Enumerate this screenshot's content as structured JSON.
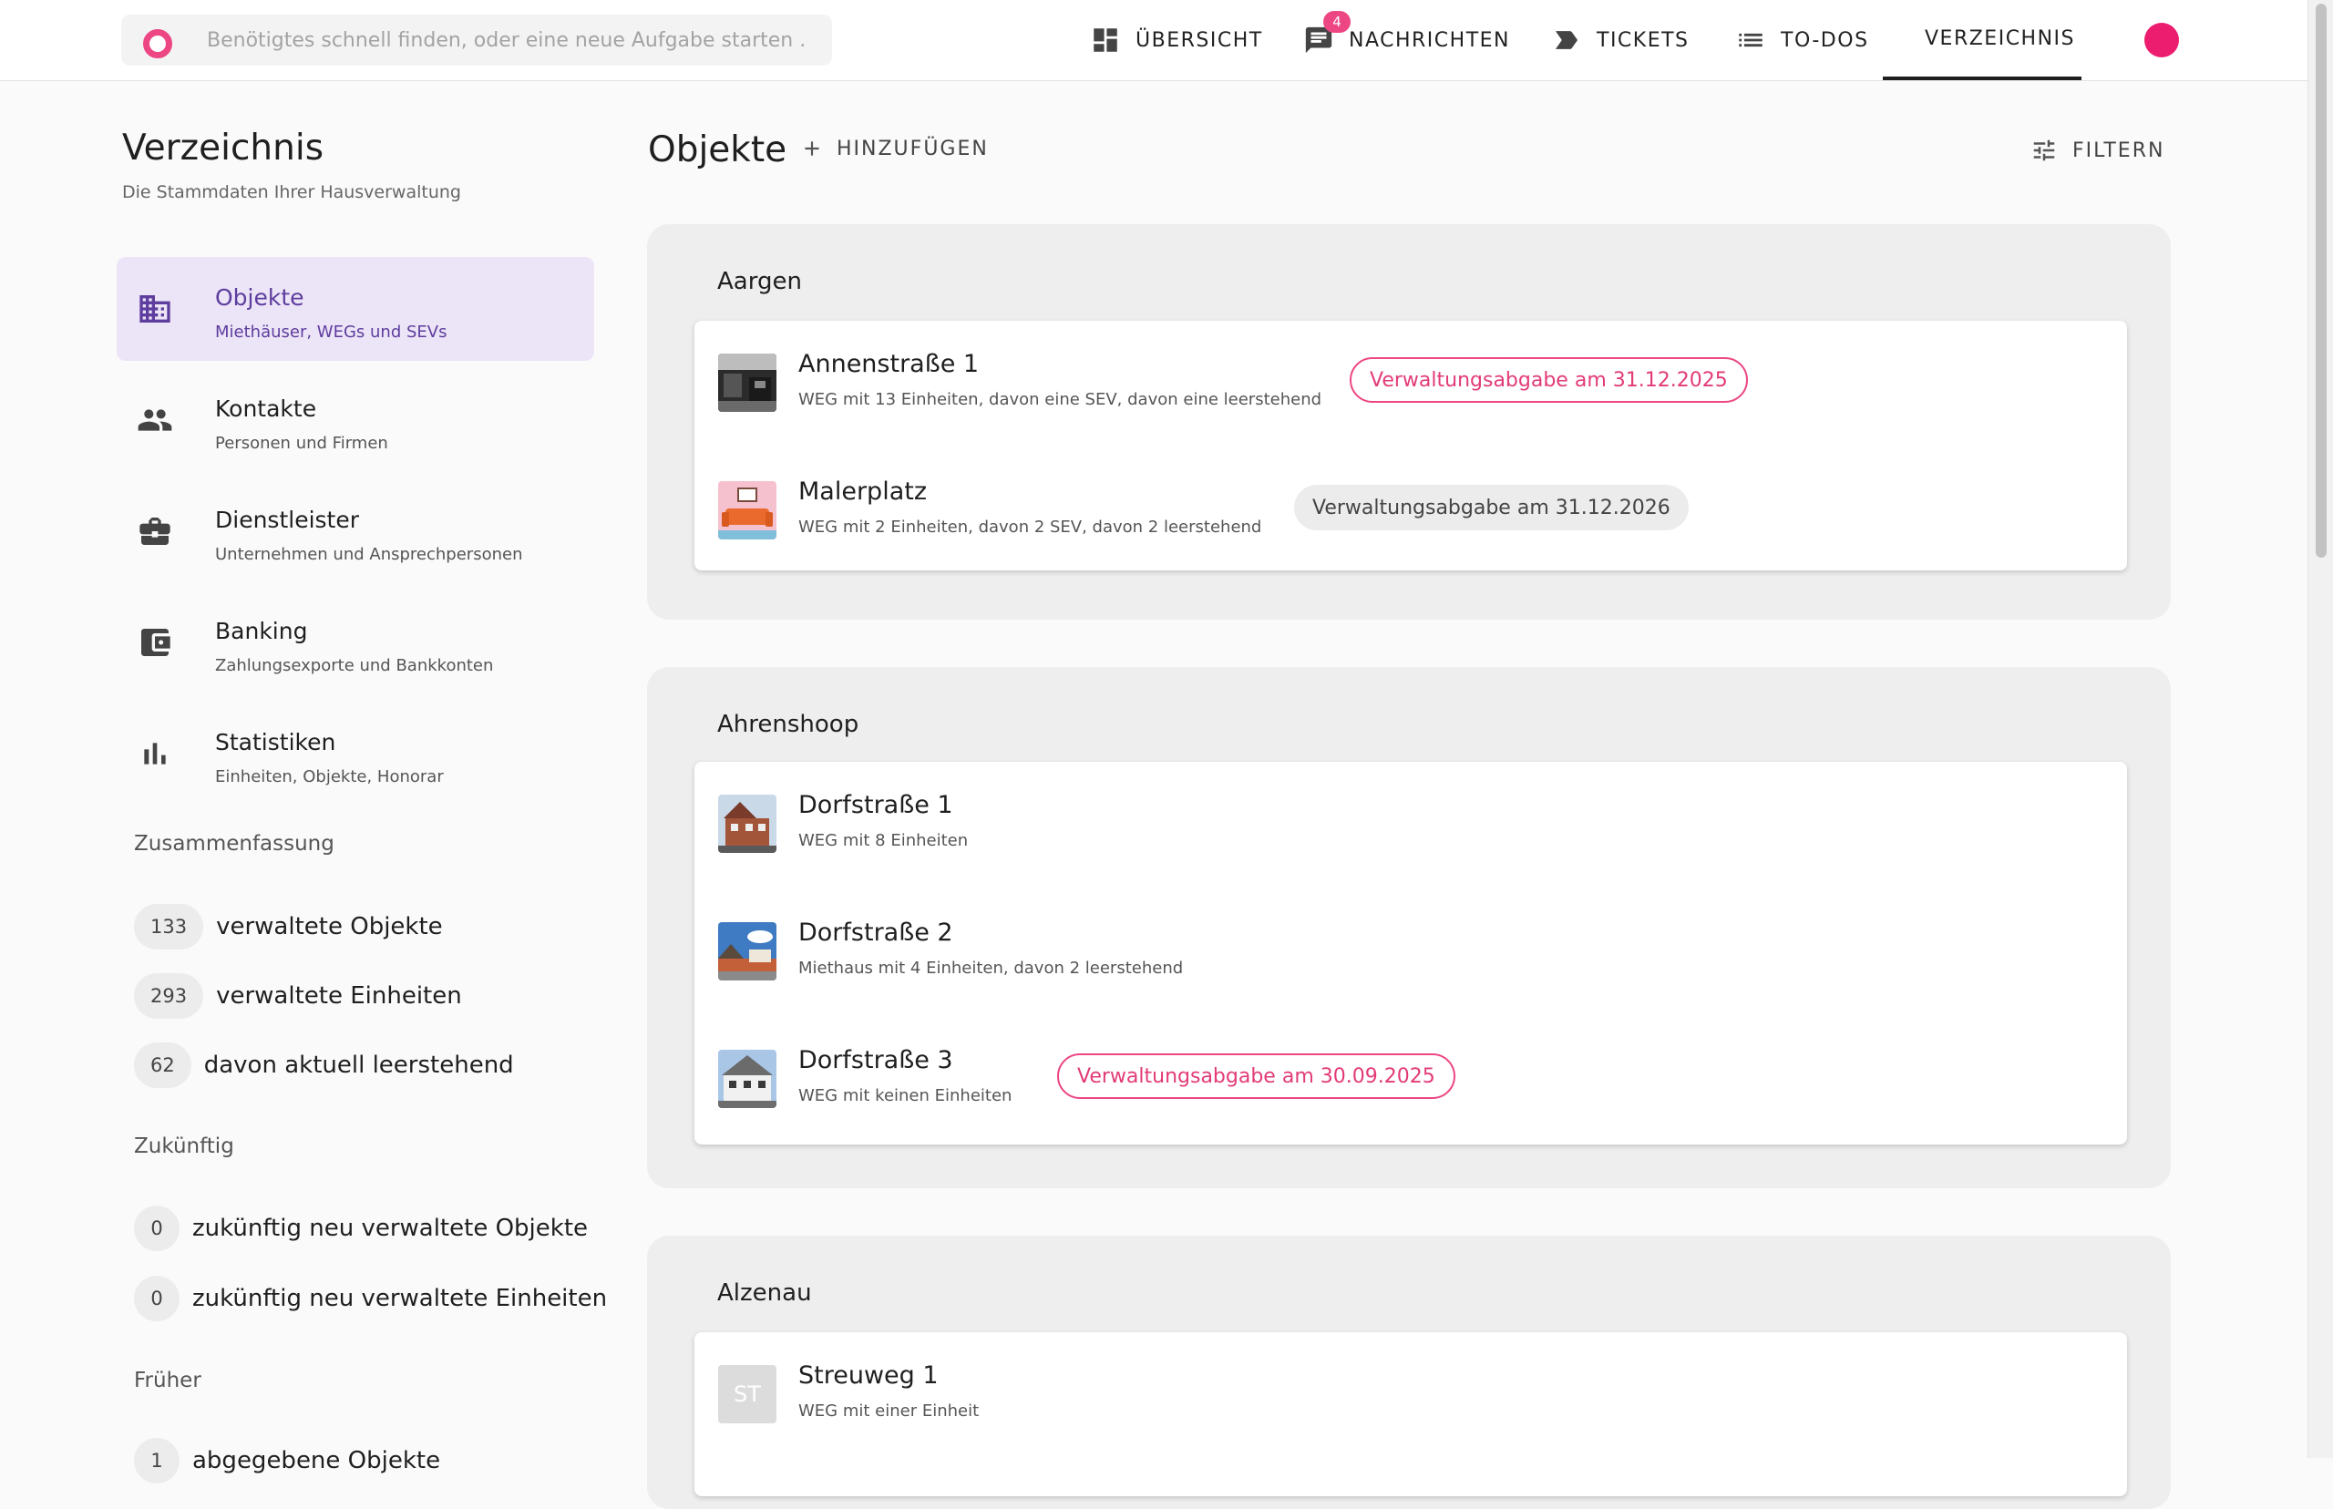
{
  "search": {
    "placeholder": "Benötigtes schnell finden, oder eine neue Aufgabe starten ..."
  },
  "nav": {
    "items": [
      {
        "label": "ÜBERSICHT",
        "icon": "dashboard-icon"
      },
      {
        "label": "NACHRICHTEN",
        "icon": "chat-icon",
        "badge": "4"
      },
      {
        "label": "TICKETS",
        "icon": "label-icon"
      },
      {
        "label": "TO-DOS",
        "icon": "list-icon"
      },
      {
        "label": "VERZEICHNIS",
        "icon": "layers-icon",
        "active": true
      }
    ]
  },
  "sidebar": {
    "title": "Verzeichnis",
    "subtitle": "Die Stammdaten Ihrer Hausverwaltung",
    "items": [
      {
        "label": "Objekte",
        "desc": "Miethäuser, WEGs und SEVs",
        "icon": "building-icon",
        "active": true
      },
      {
        "label": "Kontakte",
        "desc": "Personen und Firmen",
        "icon": "people-icon"
      },
      {
        "label": "Dienstleister",
        "desc": "Unternehmen und Ansprechpersonen",
        "icon": "briefcase-icon"
      },
      {
        "label": "Banking",
        "desc": "Zahlungsexporte und Bankkonten",
        "icon": "wallet-icon"
      },
      {
        "label": "Statistiken",
        "desc": "Einheiten, Objekte, Honorar",
        "icon": "bar-chart-icon"
      }
    ],
    "summary": {
      "heading": "Zusammenfassung",
      "stats": [
        {
          "value": "133",
          "label": "verwaltete Objekte"
        },
        {
          "value": "293",
          "label": "verwaltete Einheiten"
        },
        {
          "value": "62",
          "label": "davon aktuell leerstehend"
        }
      ]
    },
    "future": {
      "heading": "Zukünftig",
      "stats": [
        {
          "value": "0",
          "label": "zukünftig neu verwaltete Objekte"
        },
        {
          "value": "0",
          "label": "zukünftig neu verwaltete Einheiten"
        }
      ]
    },
    "past": {
      "heading": "Früher",
      "stats": [
        {
          "value": "1",
          "label": "abgegebene Objekte"
        }
      ]
    }
  },
  "main": {
    "title": "Objekte",
    "add_label": "HINZUFÜGEN",
    "filter_label": "FILTERN",
    "groups": [
      {
        "title": "Aargen",
        "rows": [
          {
            "title": "Annenstraße 1",
            "desc": "WEG mit 13 Einheiten, davon eine SEV, davon eine leerstehend",
            "tag": "Verwaltungsabgabe am 31.12.2025",
            "tag_style": "pink"
          },
          {
            "title": "Malerplatz",
            "desc": "WEG mit 2 Einheiten, davon 2 SEV, davon 2 leerstehend",
            "tag": "Verwaltungsabgabe am 31.12.2026",
            "tag_style": "grey"
          }
        ]
      },
      {
        "title": "Ahrenshoop",
        "rows": [
          {
            "title": "Dorfstraße 1",
            "desc": "WEG mit 8 Einheiten"
          },
          {
            "title": "Dorfstraße 2",
            "desc": "Miethaus mit 4 Einheiten, davon 2 leerstehend"
          },
          {
            "title": "Dorfstraße 3",
            "desc": "WEG mit keinen Einheiten",
            "tag": "Verwaltungsabgabe am 30.09.2025",
            "tag_style": "pink"
          }
        ]
      },
      {
        "title": "Alzenau",
        "rows": [
          {
            "title": "Streuweg 1",
            "desc": "WEG mit einer Einheit",
            "initials": "ST"
          }
        ]
      }
    ]
  },
  "colors": {
    "accent": "#ec4683",
    "active_menu_bg": "#ece4f7",
    "active_menu_text": "#5e3d9e"
  }
}
